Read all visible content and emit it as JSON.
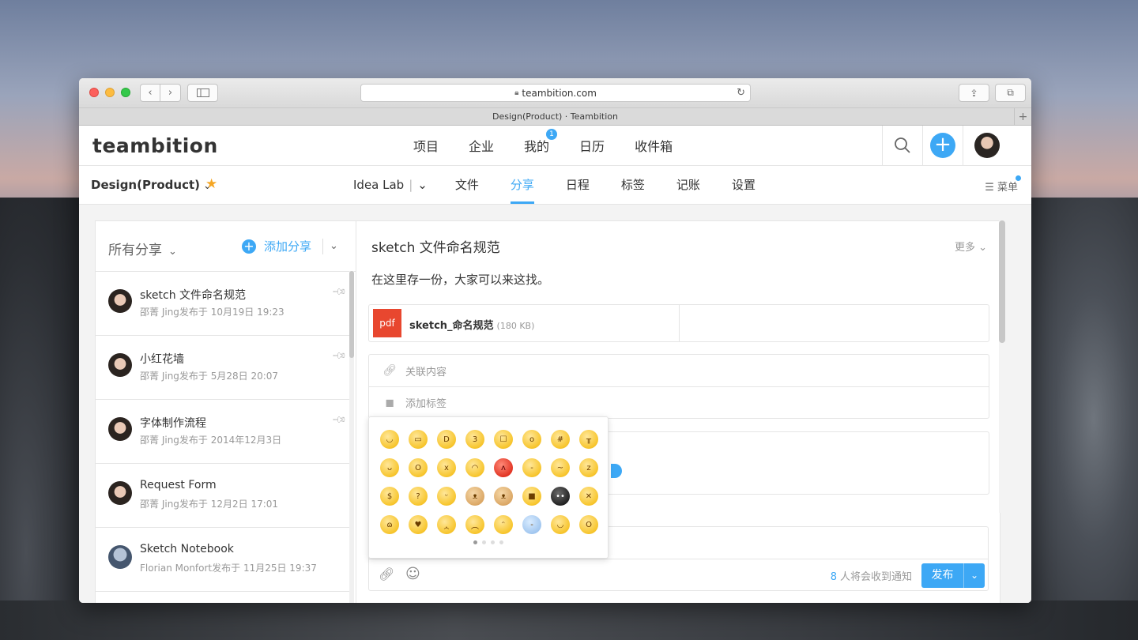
{
  "browser": {
    "url": "teambition.com",
    "tab_title": "Design(Product) · Teambition",
    "back_icon": "chevron-left-icon",
    "forward_icon": "chevron-right-icon",
    "new_tab_label": "+"
  },
  "app": {
    "logo": "teambition",
    "nav": [
      {
        "label": "项目"
      },
      {
        "label": "企业"
      },
      {
        "label": "我的",
        "badge": "1"
      },
      {
        "label": "日历"
      },
      {
        "label": "收件箱"
      }
    ],
    "add_label": "+"
  },
  "project": {
    "name": "Design(Product)",
    "tabs": [
      {
        "label": "Idea Lab"
      },
      {
        "label": "文件"
      },
      {
        "label": "分享",
        "active": true
      },
      {
        "label": "日程"
      },
      {
        "label": "标签"
      },
      {
        "label": "记账"
      },
      {
        "label": "设置"
      }
    ],
    "menu_label": "菜单"
  },
  "shares_panel": {
    "title": "所有分享",
    "add_label": "添加分享",
    "items": [
      {
        "title": "sketch 文件命名规范",
        "meta": "邵菁 Jing发布于 10月19日 19:23",
        "pinned": true
      },
      {
        "title": "小红花墙",
        "meta": "邵菁 Jing发布于 5月28日 20:07",
        "pinned": true
      },
      {
        "title": "字体制作流程",
        "meta": "邵菁 Jing发布于 2014年12月3日",
        "pinned": true
      },
      {
        "title": "Request Form",
        "meta": "邵菁 Jing发布于 12月2日 17:01",
        "pinned": false
      },
      {
        "title": "Sketch Notebook",
        "meta": "Florian Monfort发布于 11月25日 19:37",
        "pinned": false
      }
    ]
  },
  "post": {
    "title": "sketch 文件命名规范",
    "more_label": "更多",
    "body": "在这里存一份，大家可以来这找。",
    "attachment": {
      "type_label": "pdf",
      "name": "sketch_命名规范",
      "size": "(180 KB)"
    },
    "related_label": "关联内容",
    "add_tag_label": "添加标签"
  },
  "composer": {
    "notify_count": "8",
    "notify_text": "人将会收到通知",
    "publish_label": "发布"
  },
  "emoji_picker": {
    "emojis": [
      "smile",
      "grin",
      "laugh",
      "kiss",
      "shush",
      "wow",
      "zipped",
      "cry",
      "yum",
      "scream",
      "dizzy",
      "blush",
      "angry",
      "sweat",
      "pout",
      "sleepy",
      "money",
      "think",
      "joy",
      "doge",
      "cat",
      "cool",
      "panda",
      "lock",
      "hug",
      "love",
      "facepalm",
      "sad",
      "shy",
      "cold",
      "relieved",
      "yawn"
    ],
    "pages": 4,
    "current_page": 1
  },
  "colors": {
    "accent": "#3da8f5",
    "star": "#f5a623",
    "pdf": "#e8472f"
  }
}
